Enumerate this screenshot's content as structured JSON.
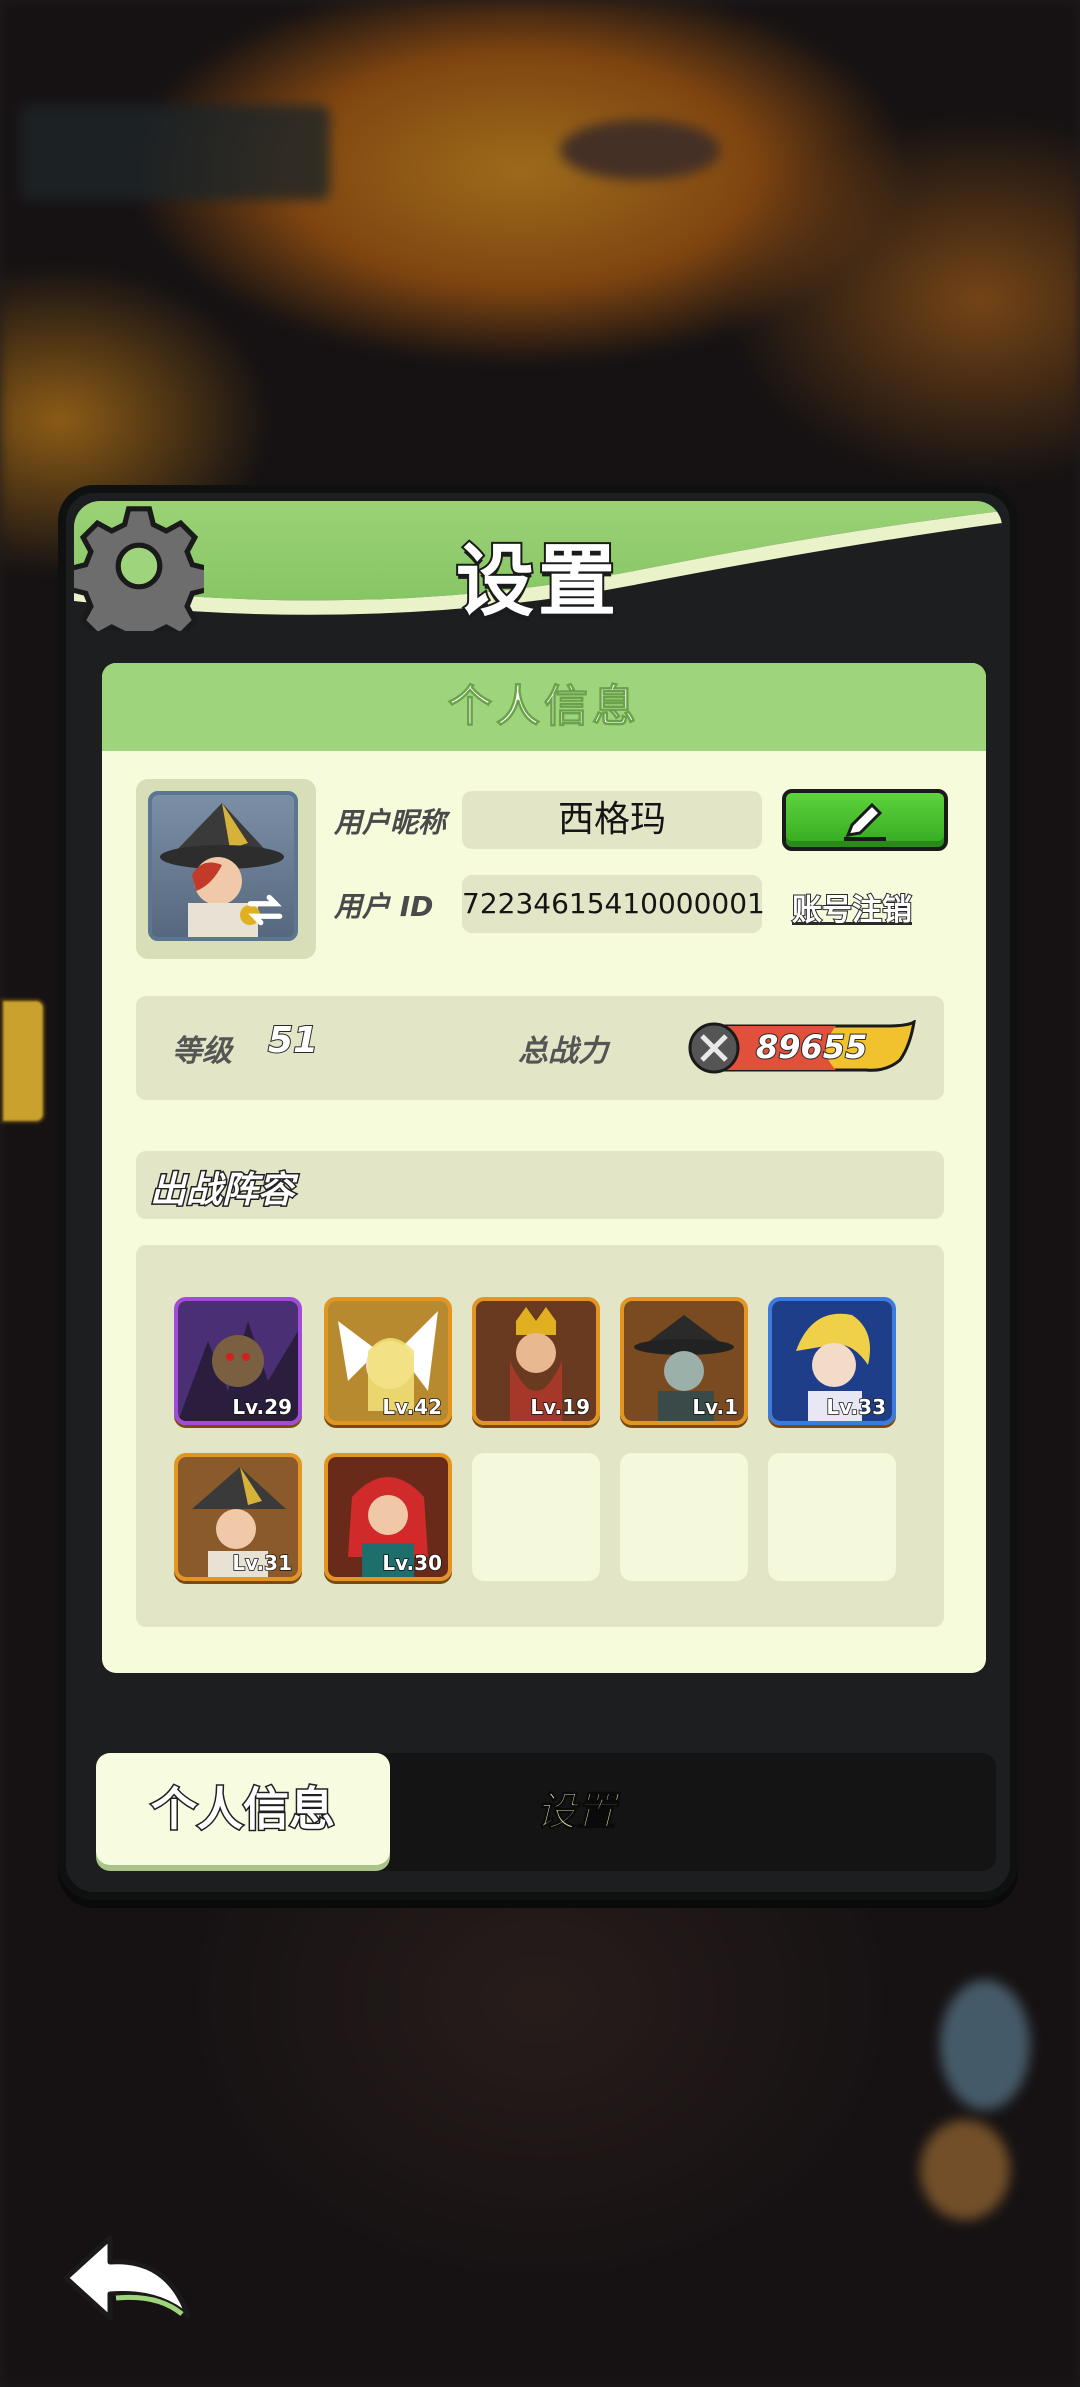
{
  "dialog": {
    "title": "设置",
    "icon": "gear-icon"
  },
  "panel": {
    "header": "个人信息",
    "nickname_label": "用户昵称",
    "nickname_value": "西格玛",
    "id_label": "用户 ID",
    "id_value": "72234615410000001",
    "edit_icon": "pencil-icon",
    "cancel_account": "账号注销",
    "level_label": "等级",
    "level_value": "51",
    "power_label": "总战力",
    "power_value": "89655"
  },
  "lineup": {
    "title": "出战阵容",
    "heroes": [
      {
        "level": "Lv.29",
        "rarity": "purple"
      },
      {
        "level": "Lv.42",
        "rarity": "orange"
      },
      {
        "level": "Lv.19",
        "rarity": "orange"
      },
      {
        "level": "Lv.1",
        "rarity": "orange"
      },
      {
        "level": "Lv.33",
        "rarity": "blue"
      },
      {
        "level": "Lv.31",
        "rarity": "orange"
      },
      {
        "level": "Lv.30",
        "rarity": "orange"
      }
    ],
    "empty_slots": 3
  },
  "tabs": {
    "active": "个人信息",
    "other": "设置"
  },
  "back_icon": "back-arrow-icon",
  "colors": {
    "header_green": "#7fc15c",
    "panel_bg": "#f6fbdc",
    "edit_green": "#34a920",
    "frame_orange": "#e49520",
    "frame_purple": "#a24bd9",
    "frame_blue": "#3b7be0"
  }
}
